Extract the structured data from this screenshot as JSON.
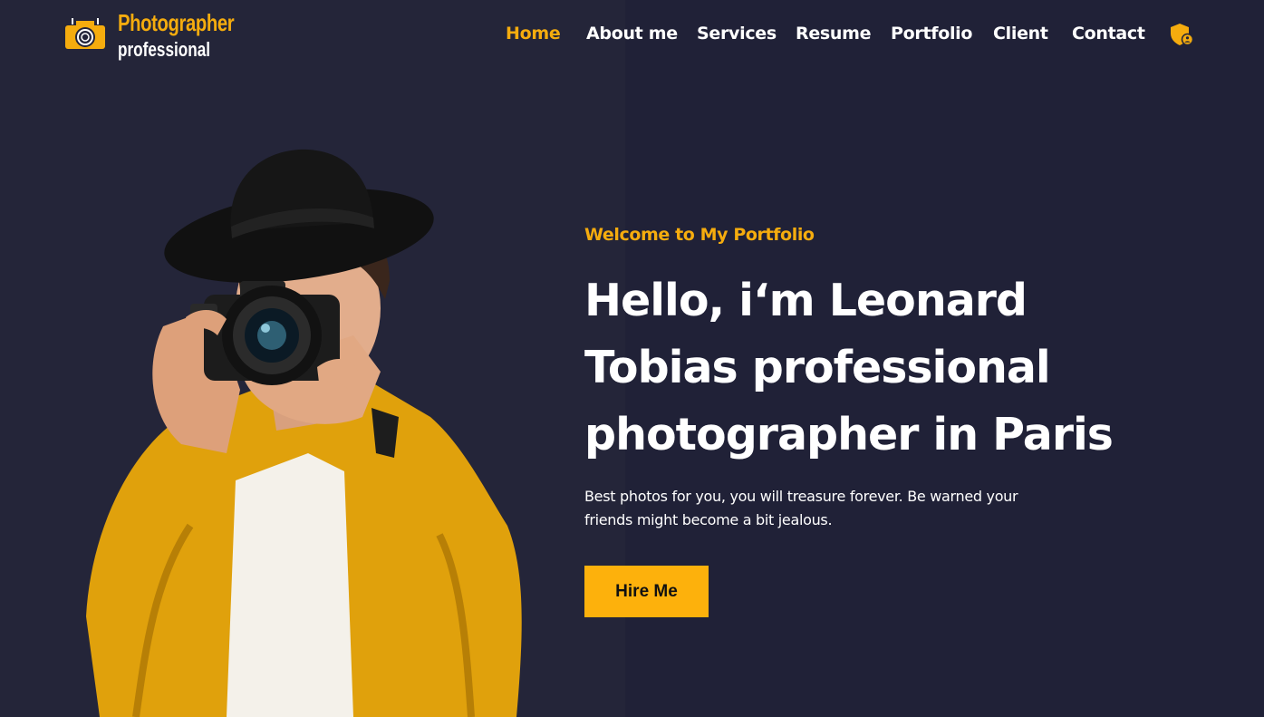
{
  "brand": {
    "line1": "Photographer",
    "line2": "professional",
    "icon": "camera-icon"
  },
  "nav": {
    "items": [
      {
        "label": "Home",
        "active": true
      },
      {
        "label": "About me",
        "active": false
      },
      {
        "label": "Services",
        "active": false
      },
      {
        "label": "Resume",
        "active": false
      },
      {
        "label": "Portfolio",
        "active": false
      },
      {
        "label": "Client",
        "active": false
      },
      {
        "label": "Contact",
        "active": false
      }
    ],
    "extra_icon": "shield-user-icon"
  },
  "hero": {
    "eyebrow": "Welcome to My Portfolio",
    "title": "Hello, i‘m Leonard Tobias professional photographer in Paris",
    "subtitle": "Best photos for you, you will treasure forever. Be warned your friends might become a bit jealous.",
    "cta_label": "Hire Me",
    "image": "photographer-with-camera"
  },
  "colors": {
    "background": "#222439",
    "accent": "#f5ac0e",
    "text": "#ffffff",
    "button": "#fdb10c"
  }
}
